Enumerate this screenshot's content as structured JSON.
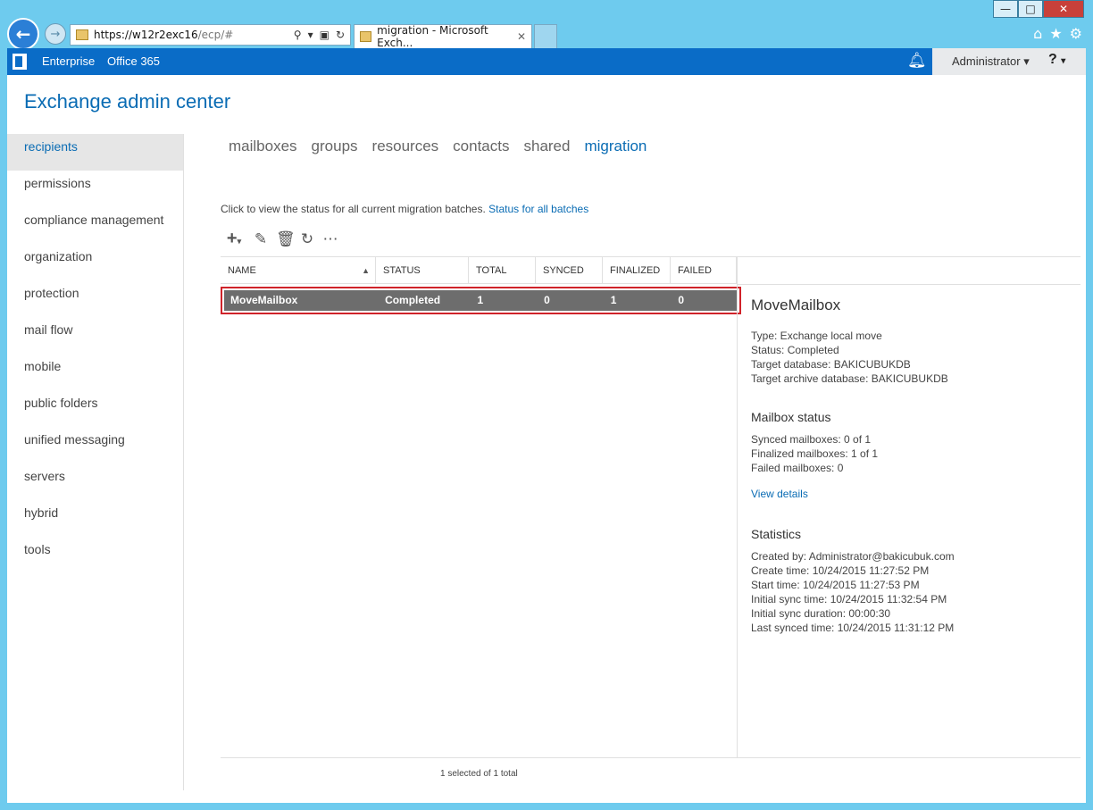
{
  "browser": {
    "url_host": "https://w12r2exc16",
    "url_path": "/ecp/#",
    "tab_title": "migration - Microsoft Exch...",
    "icons": [
      "home-icon",
      "star-icon",
      "gear-icon"
    ]
  },
  "suite": {
    "enterprise": "Enterprise",
    "office365": "Office 365",
    "user": "Administrator",
    "help": "?"
  },
  "app_title": "Exchange admin center",
  "nav": [
    "recipients",
    "permissions",
    "compliance management",
    "organization",
    "protection",
    "mail flow",
    "mobile",
    "public folders",
    "unified messaging",
    "servers",
    "hybrid",
    "tools"
  ],
  "tabs": [
    "mailboxes",
    "groups",
    "resources",
    "contacts",
    "shared",
    "migration"
  ],
  "info_text": "Click to view the status for all current migration batches.",
  "info_link": "Status for all batches",
  "columns": [
    "NAME",
    "STATUS",
    "TOTAL",
    "SYNCED",
    "FINALIZED",
    "FAILED"
  ],
  "row": {
    "name": "MoveMailbox",
    "status": "Completed",
    "total": "1",
    "synced": "0",
    "finalized": "1",
    "failed": "0"
  },
  "footer": "1 selected of 1 total",
  "detail": {
    "title": "MoveMailbox",
    "type": "Type: Exchange local move",
    "status": "Status: Completed",
    "target_db": "Target database: BAKICUBUKDB",
    "target_archive_db": "Target archive database: BAKICUBUKDB",
    "mailbox_status_title": "Mailbox status",
    "synced": "Synced mailboxes: 0 of 1",
    "finalized": "Finalized mailboxes: 1 of 1",
    "failed": "Failed mailboxes: 0",
    "view_details": "View details",
    "statistics_title": "Statistics",
    "created_by": "Created by: Administrator@bakicubuk.com",
    "create_time": "Create time: 10/24/2015 11:27:52 PM",
    "start_time": "Start time: 10/24/2015 11:27:53 PM",
    "initial_sync_time": "Initial sync time: 10/24/2015 11:32:54 PM",
    "initial_sync_duration": "Initial sync duration: 00:00:30",
    "last_synced_time": "Last synced time: 10/24/2015 11:31:12 PM"
  }
}
